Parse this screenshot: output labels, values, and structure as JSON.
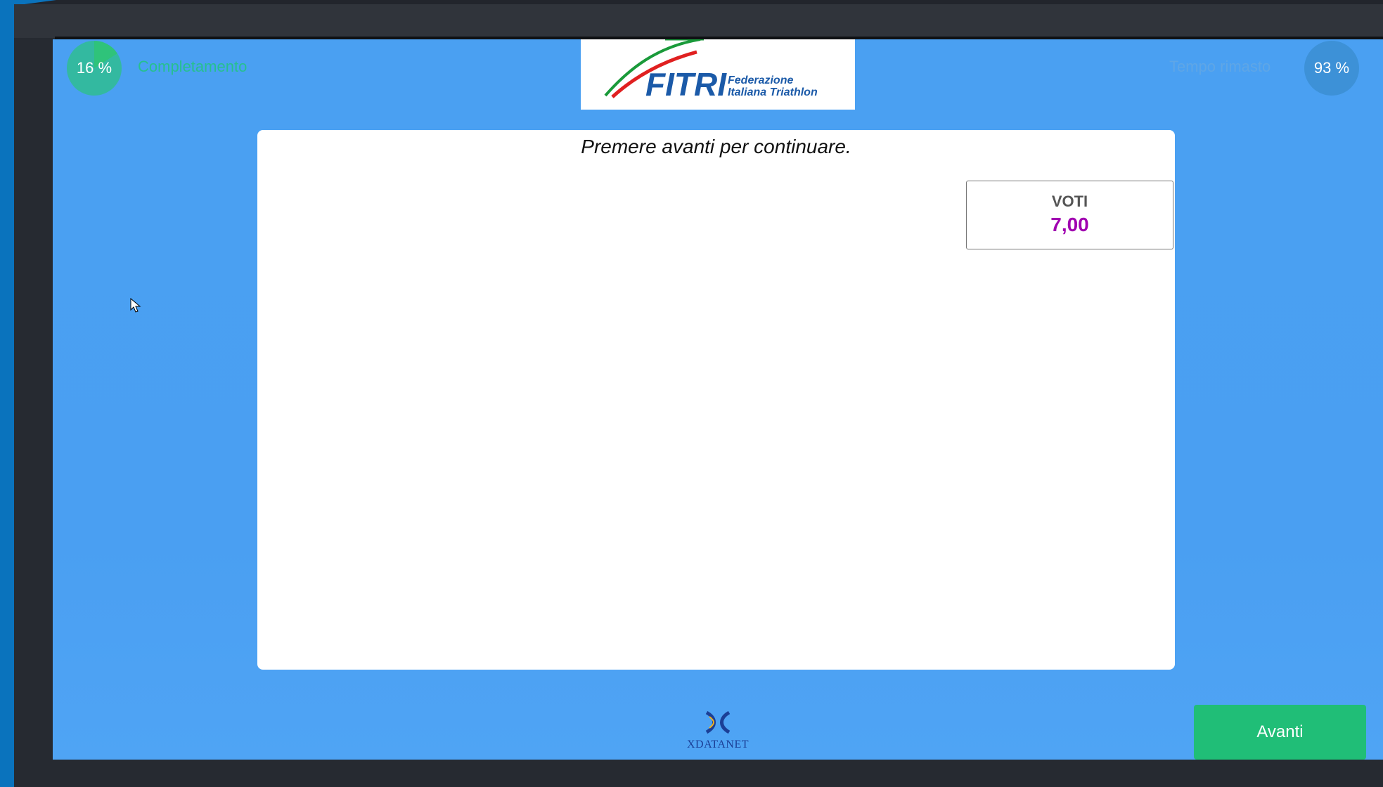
{
  "progress": {
    "completion_value": "16 %",
    "completion_label": "Completamento",
    "time_label": "Tempo rimasto",
    "time_value": "93 %"
  },
  "logo": {
    "brand": "FITRI",
    "line1": "Federazione",
    "line2": "Italiana Triathlon"
  },
  "card": {
    "instruction": "Premere avanti per continuare.",
    "votes_title": "VOTI",
    "votes_value": "7,00"
  },
  "footer": {
    "vendor": "XDATANET",
    "next_label": "Avanti"
  },
  "colors": {
    "accent_green": "#20be77",
    "vote_value": "#a000b0",
    "stage_blue": "#4aa0f2"
  }
}
